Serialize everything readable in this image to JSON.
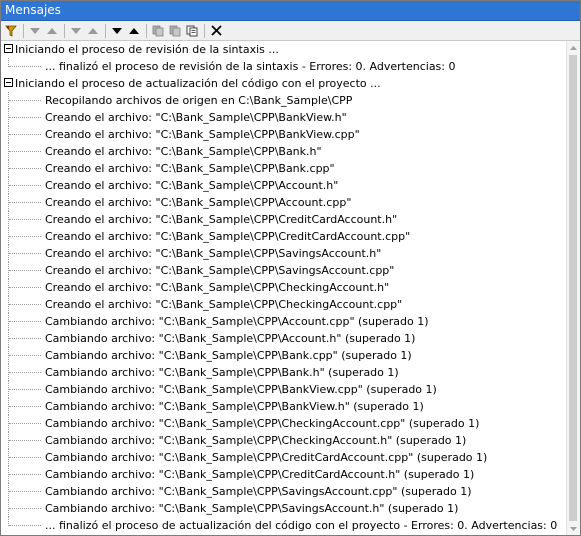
{
  "window": {
    "title": "Mensajes"
  },
  "toolbar": {
    "buttons": [
      {
        "name": "filter-button",
        "icon": "filter-icon"
      },
      {
        "name": "next-button",
        "icon": "arrow-down-icon"
      },
      {
        "name": "previous-button",
        "icon": "arrow-up-icon"
      },
      {
        "name": "next-error-button",
        "icon": "arrow-down-icon"
      },
      {
        "name": "previous-error-button",
        "icon": "arrow-up-icon"
      },
      {
        "name": "next-warning-button",
        "icon": "arrow-down-icon"
      },
      {
        "name": "previous-warning-button",
        "icon": "arrow-up-icon"
      },
      {
        "name": "copy-button",
        "icon": "copy-icon"
      },
      {
        "name": "copy-all-button",
        "icon": "copy-all-icon"
      },
      {
        "name": "find-button",
        "icon": "find-icon"
      },
      {
        "name": "clear-button",
        "icon": "close-icon"
      }
    ]
  },
  "messages": {
    "groups": [
      {
        "header": "Iniciando el proceso de revisión de la sintaxis ...",
        "items": [
          "... finalizó el proceso de revisión de la sintaxis - Errores: 0. Advertencias: 0"
        ]
      },
      {
        "header": "Iniciando el proceso de actualización del código con el proyecto ...",
        "items": [
          "Recopilando archivos de origen en C:\\Bank_Sample\\CPP",
          "Creando el archivo: \"C:\\Bank_Sample\\CPP\\BankView.h\"",
          "Creando el archivo: \"C:\\Bank_Sample\\CPP\\BankView.cpp\"",
          "Creando el archivo: \"C:\\Bank_Sample\\CPP\\Bank.h\"",
          "Creando el archivo: \"C:\\Bank_Sample\\CPP\\Bank.cpp\"",
          "Creando el archivo: \"C:\\Bank_Sample\\CPP\\Account.h\"",
          "Creando el archivo: \"C:\\Bank_Sample\\CPP\\Account.cpp\"",
          "Creando el archivo: \"C:\\Bank_Sample\\CPP\\CreditCardAccount.h\"",
          "Creando el archivo: \"C:\\Bank_Sample\\CPP\\CreditCardAccount.cpp\"",
          "Creando el archivo: \"C:\\Bank_Sample\\CPP\\SavingsAccount.h\"",
          "Creando el archivo: \"C:\\Bank_Sample\\CPP\\SavingsAccount.cpp\"",
          "Creando el archivo: \"C:\\Bank_Sample\\CPP\\CheckingAccount.h\"",
          "Creando el archivo: \"C:\\Bank_Sample\\CPP\\CheckingAccount.cpp\"",
          "Cambiando archivo: \"C:\\Bank_Sample\\CPP\\Account.cpp\" (superado 1)",
          "Cambiando archivo: \"C:\\Bank_Sample\\CPP\\Account.h\" (superado 1)",
          "Cambiando archivo: \"C:\\Bank_Sample\\CPP\\Bank.cpp\" (superado 1)",
          "Cambiando archivo: \"C:\\Bank_Sample\\CPP\\Bank.h\" (superado 1)",
          "Cambiando archivo: \"C:\\Bank_Sample\\CPP\\BankView.cpp\" (superado 1)",
          "Cambiando archivo: \"C:\\Bank_Sample\\CPP\\BankView.h\" (superado 1)",
          "Cambiando archivo: \"C:\\Bank_Sample\\CPP\\CheckingAccount.cpp\" (superado 1)",
          "Cambiando archivo: \"C:\\Bank_Sample\\CPP\\CheckingAccount.h\" (superado 1)",
          "Cambiando archivo: \"C:\\Bank_Sample\\CPP\\CreditCardAccount.cpp\" (superado 1)",
          "Cambiando archivo: \"C:\\Bank_Sample\\CPP\\CreditCardAccount.h\" (superado 1)",
          "Cambiando archivo: \"C:\\Bank_Sample\\CPP\\SavingsAccount.cpp\" (superado 1)",
          "Cambiando archivo: \"C:\\Bank_Sample\\CPP\\SavingsAccount.h\" (superado 1)",
          "... finalizó el proceso de actualización del código con el proyecto - Errores: 0. Advertencias: 0"
        ]
      }
    ]
  },
  "colors": {
    "titlebar": "#2f76d4",
    "toolbar": "#f0f0f0"
  }
}
